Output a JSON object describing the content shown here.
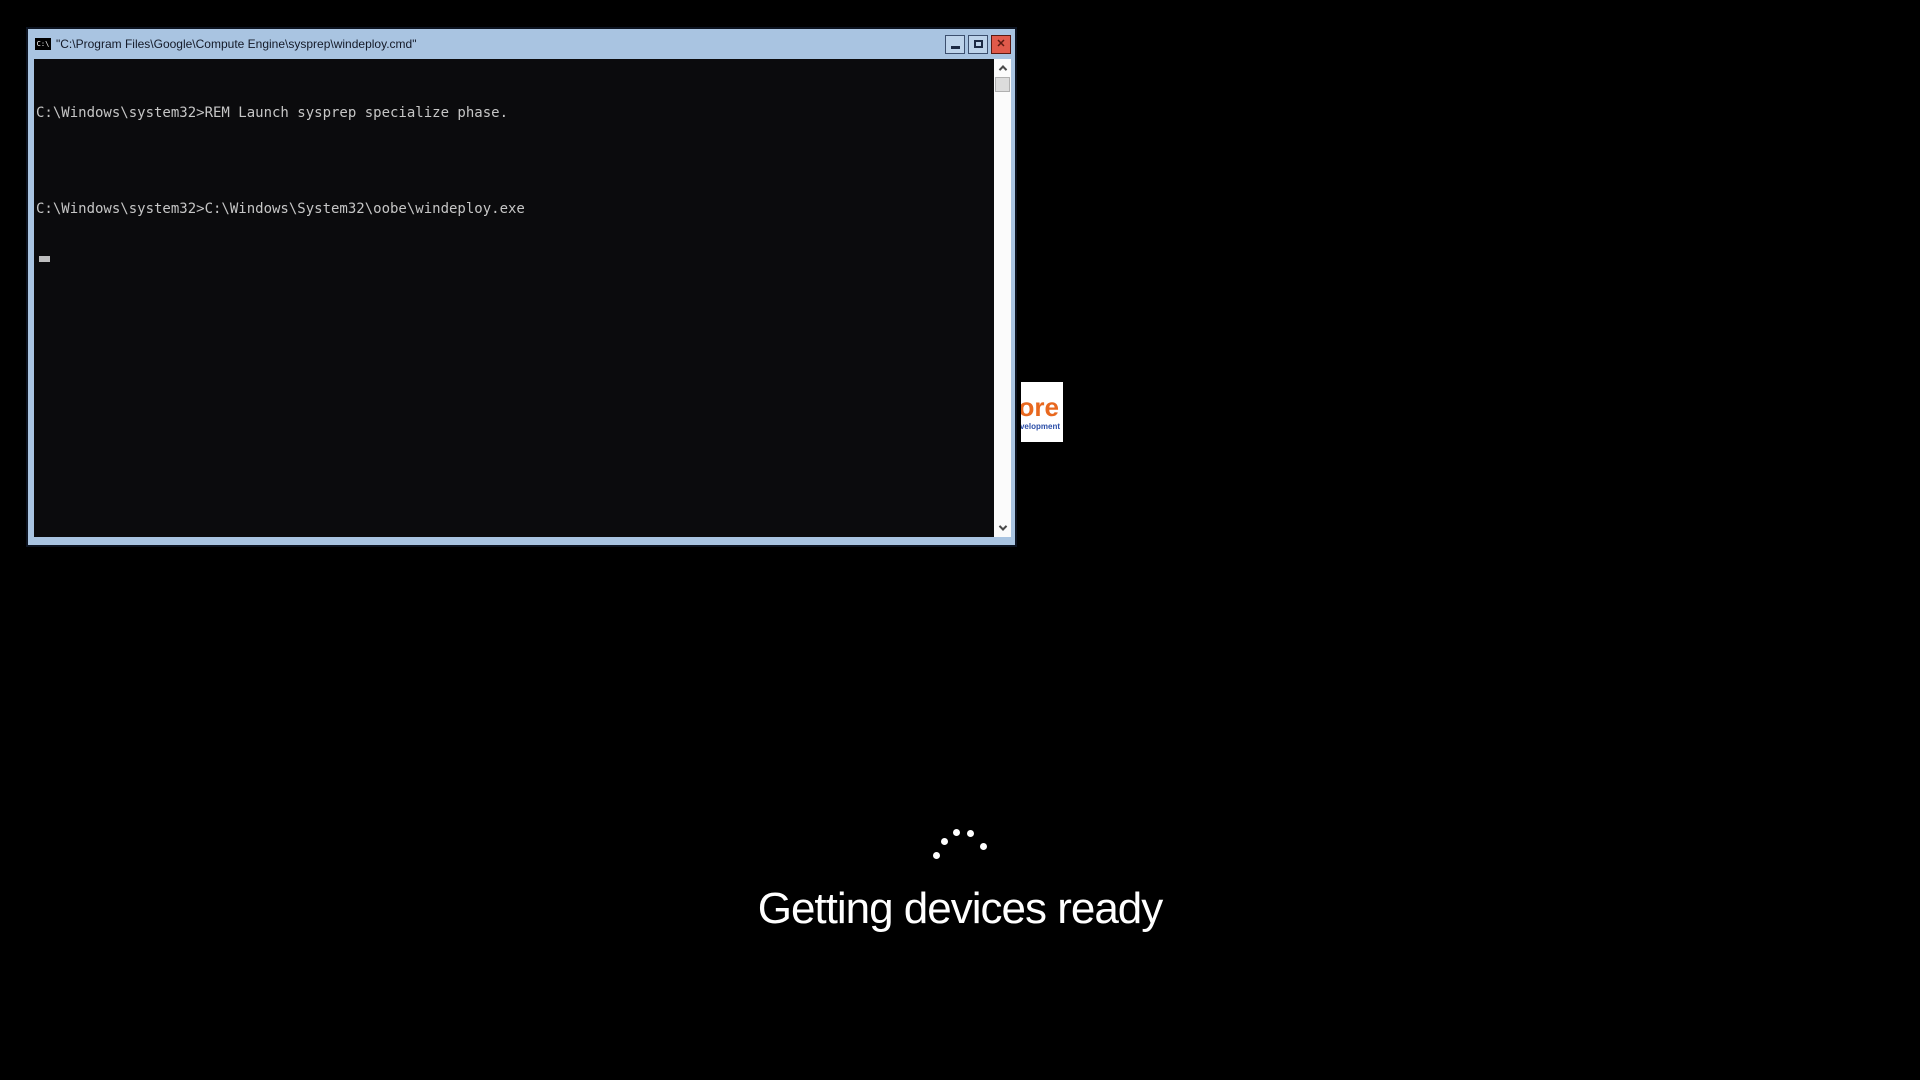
{
  "oobe_screen": {
    "background_color": "#000000",
    "status_text": "Getting devices ready",
    "spinner": {
      "dot_count": 5,
      "color": "#ffffff"
    }
  },
  "console_window": {
    "titlebar": {
      "icon": "cmd-icon",
      "icon_text": "C:\\",
      "title": "\"C:\\Program Files\\Google\\Compute Engine\\sysprep\\windeploy.cmd\"",
      "minimize": "minimize-button",
      "maximize": "maximize-button",
      "close_glyph": "✕"
    },
    "console": {
      "background": "#0b0b0d",
      "text_color": "#c6c6c6",
      "lines": [
        "C:\\Windows\\system32>REM Launch sysprep specialize phase.",
        "",
        "C:\\Windows\\system32>C:\\Windows\\System32\\oobe\\windeploy.exe"
      ]
    },
    "scrollbar": {
      "up_icon": "chevron-up",
      "down_icon": "chevron-down"
    },
    "colors": {
      "titlebar_bg": "#a9c4e1",
      "button_bg": "#bdd3ea",
      "close_bg": "#e05a4b",
      "frame_outline": "#0c1320"
    }
  },
  "partial_logo_window": {
    "primary_text": "ore",
    "primary_color": "#e8681f",
    "secondary_text": "velopment",
    "secondary_color": "#2b4ea8"
  }
}
